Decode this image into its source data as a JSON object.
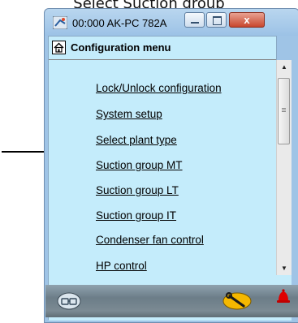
{
  "caption": "Select Suction group",
  "window": {
    "title": "00:000 AK-PC 782A",
    "buttons": {
      "close_label": "x"
    }
  },
  "menu": {
    "header": "Configuration menu",
    "items": [
      {
        "label": "Lock/Unlock configuration"
      },
      {
        "label": "System setup"
      },
      {
        "label": "Select plant type"
      },
      {
        "label": "Suction group MT"
      },
      {
        "label": "Suction group LT"
      },
      {
        "label": "Suction group IT"
      },
      {
        "label": "Condenser fan control"
      },
      {
        "label": "HP control"
      }
    ],
    "pointed_item": "Suction group MT"
  },
  "scrollbar": {
    "position_fraction": 0.0
  },
  "status": {
    "icons": [
      "online-icon",
      "wrench-icon",
      "alarm-bell-icon"
    ]
  },
  "colors": {
    "client_background": "#c4ecfb",
    "alarm": "#e00000",
    "wrench_badge": "#f5b800"
  }
}
